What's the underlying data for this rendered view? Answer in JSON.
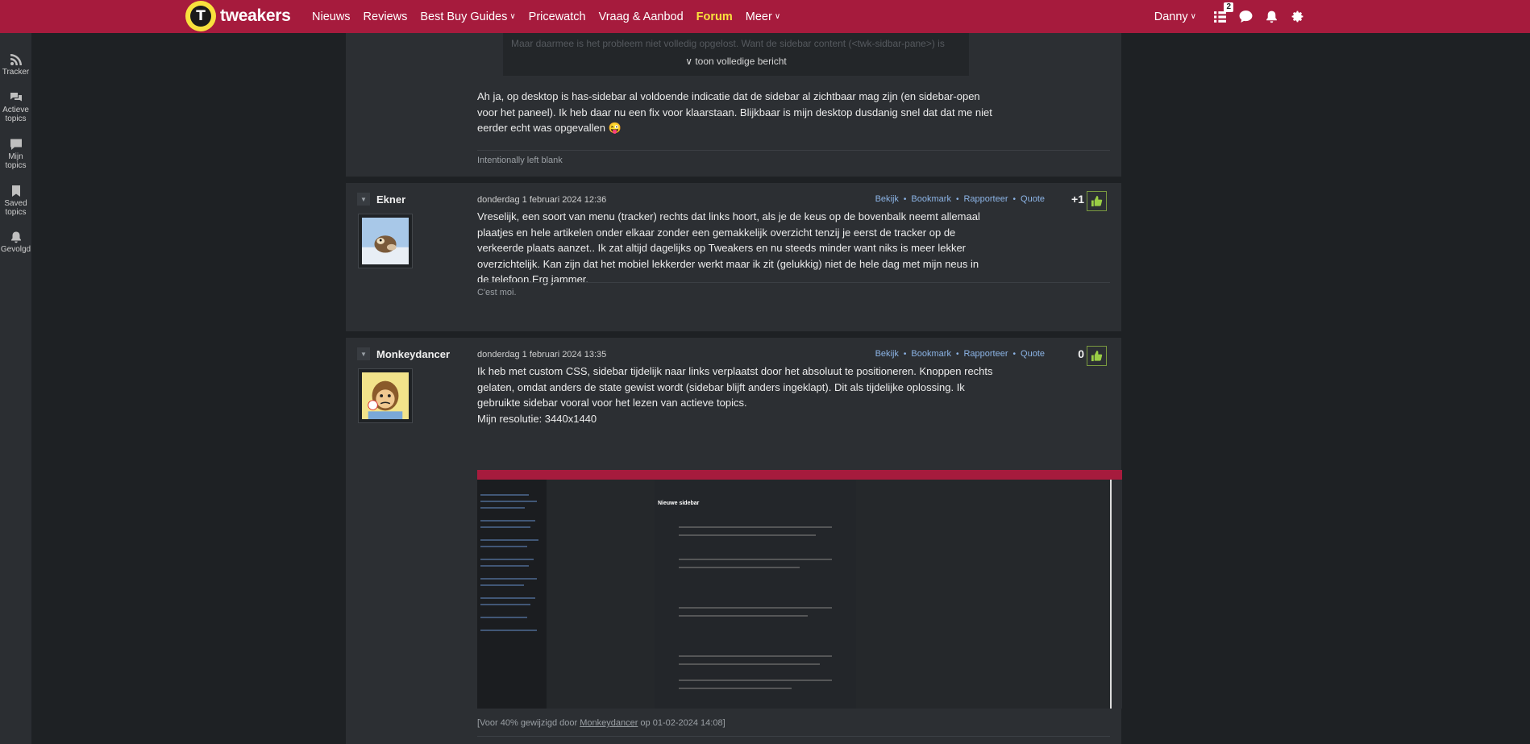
{
  "header": {
    "logo_text": "tweakers",
    "logo_letter": "T",
    "nav": [
      {
        "label": "Nieuws"
      },
      {
        "label": "Reviews"
      },
      {
        "label": "Best Buy Guides",
        "dropdown": true
      },
      {
        "label": "Pricewatch"
      },
      {
        "label": "Vraag & Aanbod"
      },
      {
        "label": "Forum",
        "active": true
      },
      {
        "label": "Meer",
        "dropdown": true
      }
    ],
    "user": "Danny",
    "notification_count": "2",
    "accent_color": "#a61b3d",
    "active_color": "#f9e13d"
  },
  "sidebar": {
    "items": [
      {
        "label": "Tracker",
        "icon": "rss-icon"
      },
      {
        "label": "Actieve topics",
        "icon": "chat-bubbles-icon"
      },
      {
        "label": "Mijn topics",
        "icon": "chat-bubble-icon"
      },
      {
        "label": "Saved topics",
        "icon": "bookmark-icon"
      },
      {
        "label": "Gevolgd",
        "icon": "bell-icon"
      }
    ]
  },
  "posts": [
    {
      "quote_faded": "Maar daarmee is het probleem niet volledig opgelost. Want de sidebar content (<twk-sidbar-pane>) is",
      "quote_expand": "toon volledige bericht",
      "body": "Ah ja, op desktop is has-sidebar al voldoende indicatie dat de sidebar al zichtbaar mag zijn (en sidebar-open voor het paneel). Ik heb daar nu een fix voor klaarstaan. Blijkbaar is mijn desktop dusdanig snel dat dat me niet eerder echt was opgevallen",
      "emoji": "😜",
      "signature": "Intentionally left blank"
    },
    {
      "author": "Ekner",
      "date": "donderdag 1 februari 2024 12:36",
      "score": "+1",
      "body": "Vreselijk, een soort van menu (tracker) rechts dat links hoort, als je de keus op de bovenbalk neemt allemaal plaatjes en hele artikelen onder elkaar zonder een gemakkelijk overzicht tenzij je eerst de tracker op de verkeerde plaats aanzet.. Ik zat altijd dagelijks op Tweakers en nu steeds minder want niks is meer lekker overzichtelijk. Kan zijn dat het mobiel lekkerder werkt maar ik zit (gelukkig) niet de hele dag met mijn neus in de telefoon.Erg jammer.",
      "signature": "C'est moi."
    },
    {
      "author": "Monkeydancer",
      "date": "donderdag 1 februari 2024 13:35",
      "score": "0",
      "body": "Ik heb met custom CSS, sidebar tijdelijk naar links verplaatst door het absoluut te positioneren. Knoppen rechts gelaten, omdat anders de state gewist wordt (sidebar blijft anders ingeklapt). Dit als tijdelijke oplossing. Ik gebruikte sidebar vooral voor het lezen van actieve topics.",
      "resolution": "Mijn resolutie: 3440x1440",
      "screenshot_title": "Nieuwe sidebar",
      "edit_prefix": "[Voor 40% gewijzigd door",
      "edit_user": "Monkeydancer",
      "edit_suffix": "op 01-02-2024 14:08]"
    }
  ],
  "post_actions": {
    "view": "Bekijk",
    "bookmark": "Bookmark",
    "report": "Rapporteer",
    "quote": "Quote"
  }
}
